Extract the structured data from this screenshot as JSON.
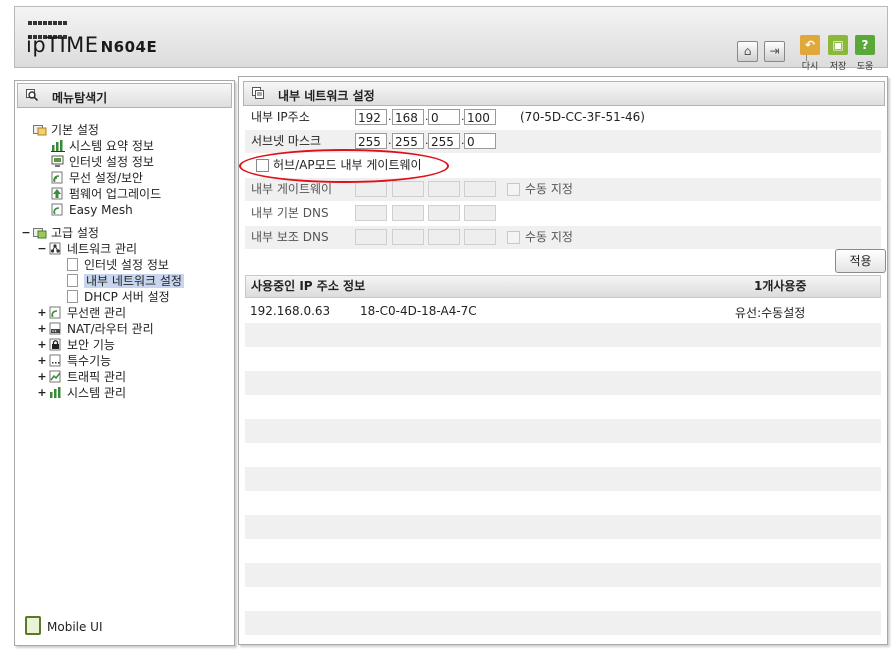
{
  "header": {
    "brand": "ipTIME",
    "model": "N604E",
    "buttons": [
      {
        "label": "다시",
        "icon": "undo-icon"
      },
      {
        "label": "저장",
        "icon": "save-icon"
      },
      {
        "label": "도움",
        "icon": "help-icon"
      }
    ],
    "home_icon": "home-icon",
    "logout_icon": "logout-icon"
  },
  "sidebar": {
    "title": "메뉴탐색기",
    "basic": {
      "label": "기본 설정",
      "items": [
        "시스템 요약 정보",
        "인터넷 설정 정보",
        "무선 설정/보안",
        "펌웨어 업그레이드",
        "Easy Mesh"
      ]
    },
    "advanced": {
      "label": "고급 설정",
      "network": {
        "label": "네트워크 관리",
        "items": [
          "인터넷 설정 정보",
          "내부 네트워크 설정",
          "DHCP 서버 설정"
        ],
        "selected": "내부 네트워크 설정"
      },
      "items": [
        "무선랜 관리",
        "NAT/라우터 관리",
        "보안 기능",
        "특수기능",
        "트래픽 관리",
        "시스템 관리"
      ]
    },
    "mobile_ui": "Mobile UI"
  },
  "main": {
    "title": "내부 네트워크 설정",
    "ip_label": "내부 IP주소",
    "ip": [
      "192",
      "168",
      "0",
      "100"
    ],
    "mac": "(70-5D-CC-3F-51-46)",
    "subnet_label": "서브넷 마스크",
    "subnet": [
      "255",
      "255",
      "255",
      "0"
    ],
    "hub_ap_label": "허브/AP모드 내부 게이트웨이",
    "gateway_label": "내부 게이트웨이",
    "manual_label": "수동 지정",
    "dns1_label": "내부 기본 DNS",
    "dns2_label": "내부 보조 DNS",
    "apply_label": "적용",
    "list_title": "사용중인 IP 주소 정보",
    "list_count": "1개사용중",
    "clients": [
      {
        "ip": "192.168.0.63",
        "mac": "18-C0-4D-18-A4-7C",
        "type": "유선:수동설정"
      }
    ]
  }
}
